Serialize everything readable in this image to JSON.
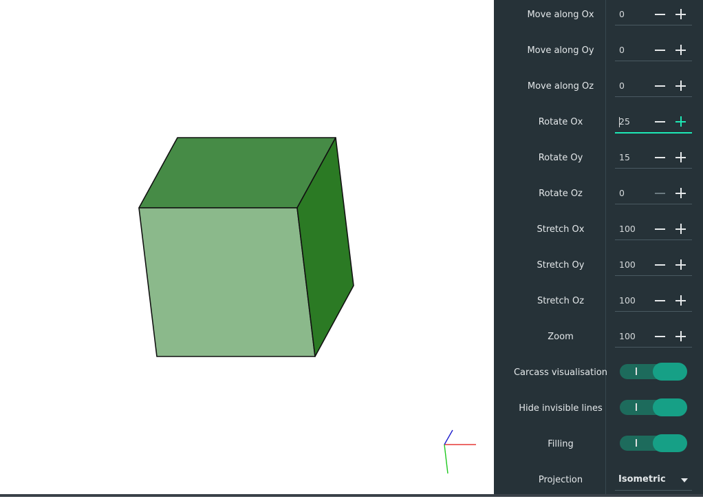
{
  "colors": {
    "panel_bg": "#263238",
    "accent": "#1de9b6",
    "cube_top": "#468b46",
    "cube_front": "#8bb98b",
    "cube_side": "#2b7a24",
    "axis_x": "#e53935",
    "axis_y": "#1ec81e",
    "axis_z": "#1a1acc"
  },
  "viewport": {
    "object": "cube",
    "axis_gizmo": [
      "x",
      "y",
      "z"
    ]
  },
  "controls": [
    {
      "label": "Move along Ox",
      "value": "0"
    },
    {
      "label": "Move along Oy",
      "value": "0"
    },
    {
      "label": "Move along Oz",
      "value": "0"
    },
    {
      "label": "Rotate Ox",
      "value": "25",
      "focused": true
    },
    {
      "label": "Rotate Oy",
      "value": "15"
    },
    {
      "label": "Rotate Oz",
      "value": "0",
      "minus_disabled": true
    },
    {
      "label": "Stretch Ox",
      "value": "100"
    },
    {
      "label": "Stretch Oy",
      "value": "100"
    },
    {
      "label": "Stretch Oz",
      "value": "100"
    },
    {
      "label": "Zoom",
      "value": "100"
    }
  ],
  "toggles": [
    {
      "label": "Carcass visualisation",
      "on": true,
      "mark": "I"
    },
    {
      "label": "Hide invisible lines",
      "on": true,
      "mark": "I"
    },
    {
      "label": "Filling",
      "on": true,
      "mark": "I"
    }
  ],
  "projection": {
    "label": "Projection",
    "value": "Isometric",
    "icon": "dropdown-arrow-icon"
  },
  "icons": {
    "minus": "minus-icon",
    "plus": "plus-icon"
  }
}
